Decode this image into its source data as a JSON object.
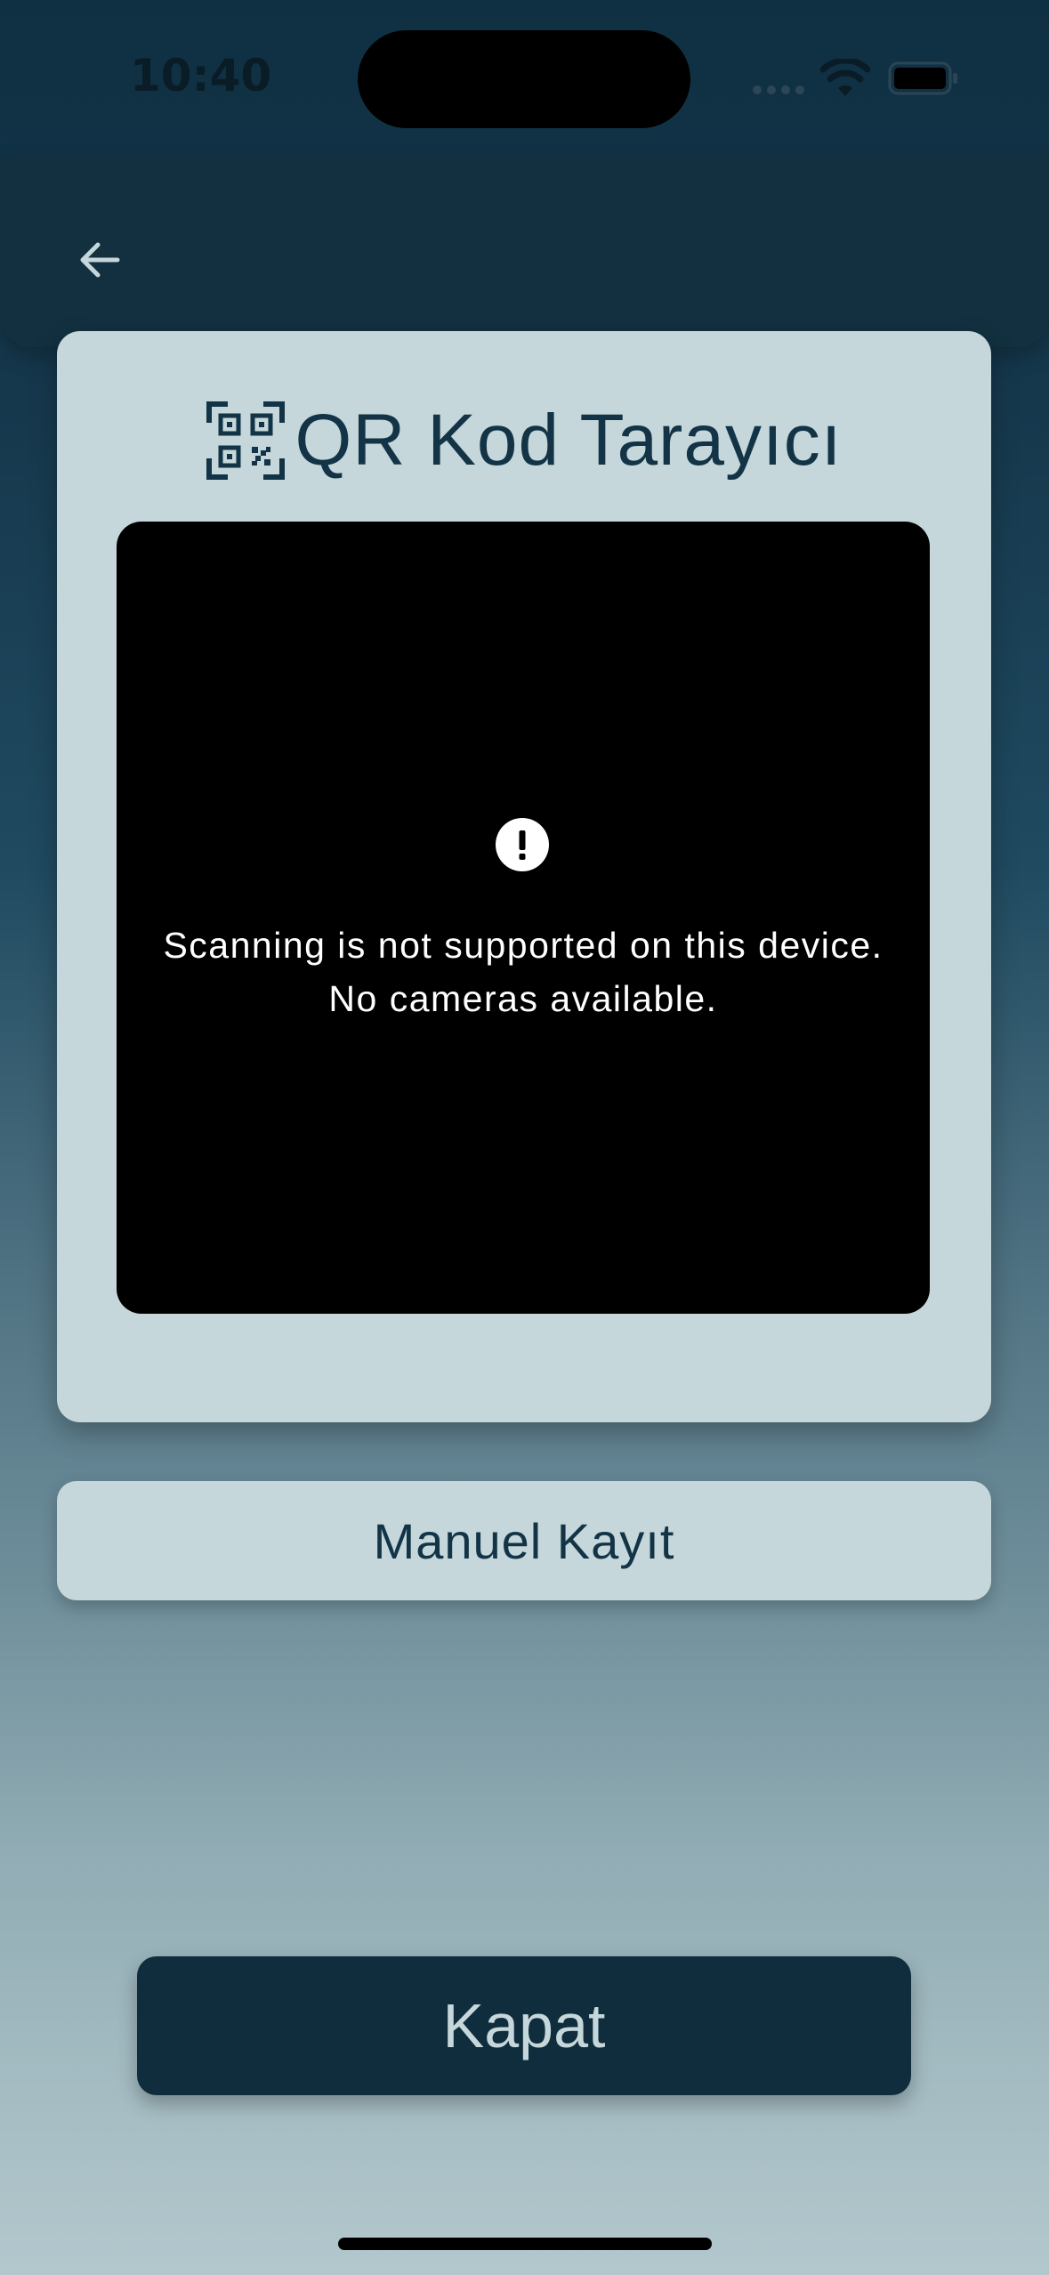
{
  "status_bar": {
    "time": "10:40"
  },
  "app_bar": {
    "back_icon": "arrow-left-icon"
  },
  "scanner": {
    "icon": "qr-code-scan-icon",
    "title": "QR Kod Tarayıcı",
    "alert_icon": "exclamation-circle-icon",
    "error_line1": "Scanning is not supported on this device.",
    "error_line2": "No cameras available."
  },
  "actions": {
    "manual_label": "Manuel Kayıt",
    "close_label": "Kapat"
  },
  "colors": {
    "primary_dark": "#0f2d3d",
    "card_surface": "#c5d7da",
    "title_text": "#123446"
  }
}
